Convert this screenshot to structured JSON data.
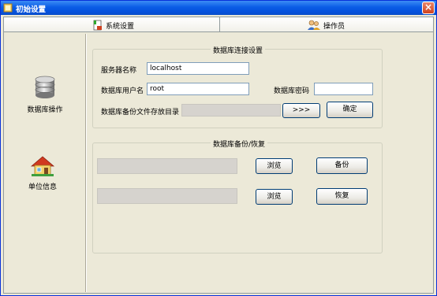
{
  "window": {
    "title": "初始设置"
  },
  "tabs": [
    {
      "label": "系统设置"
    },
    {
      "label": "操作员"
    }
  ],
  "sidebar": {
    "items": [
      {
        "label": "数据库操作",
        "icon": "database-icon"
      },
      {
        "label": "单位信息",
        "icon": "house-icon"
      }
    ]
  },
  "connection": {
    "group_title": "数据库连接设置",
    "server_label": "服务器名称",
    "server_value": "localhost",
    "user_label": "数据库用户名",
    "user_value": "root",
    "password_label": "数据库密码",
    "password_value": "",
    "backup_dir_label": "数据库备份文件存放目录",
    "backup_dir_value": "",
    "browse_dir_button": ">>>",
    "confirm_button": "确定"
  },
  "backup": {
    "group_title": "数据库备份/恢复",
    "backup_path_value": "",
    "browse_backup_button": "浏览",
    "backup_button": "备份",
    "restore_path_value": "",
    "browse_restore_button": "浏览",
    "restore_button": "恢复"
  },
  "colors": {
    "titlebar": "#0a5de6",
    "background": "#ece9d8",
    "accent": "#003c74"
  }
}
